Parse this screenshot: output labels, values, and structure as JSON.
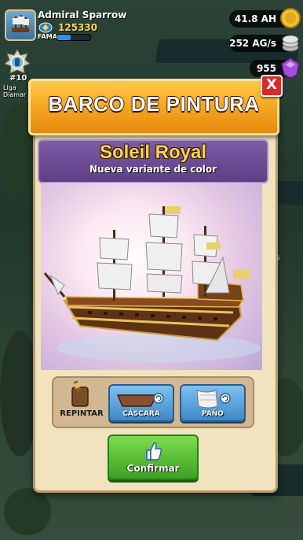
{
  "player": {
    "name": "Admiral Sparrow",
    "fame_label": "FAMA",
    "fame_value": "125330",
    "fame_progress": 0.4
  },
  "rank": {
    "number": "#10",
    "league": "Liga Diamar"
  },
  "resources": [
    {
      "value": "41.8 AH",
      "icon": "gold-coin-icon",
      "color": "#e8b321"
    },
    {
      "value": "252 AG/s",
      "icon": "coin-stack-icon",
      "color": "#c9c9c9"
    },
    {
      "value": "955",
      "icon": "purple-gem-icon",
      "color": "#9b3fd6"
    }
  ],
  "dialog": {
    "title": "BARCO DE PINTURA",
    "close_symbol": "X",
    "ship_name": "Soleil Royal",
    "ship_subtitle": "Nueva variante de color",
    "repaint_label": "REPINTAR",
    "options": [
      {
        "label": "CÁSCARA",
        "icon": "hull-icon"
      },
      {
        "label": "PAÑO",
        "icon": "sail-cloth-icon"
      }
    ],
    "confirm_label": "Confirmar"
  },
  "background": {
    "side_text": "blos"
  },
  "colors": {
    "header": "#f6a21f",
    "name_panel": "#6e4d98",
    "ship_name": "#ffd24a",
    "option_button": "#4e97d3",
    "confirm_button": "#55b92f",
    "close_button": "#d72a2a"
  }
}
